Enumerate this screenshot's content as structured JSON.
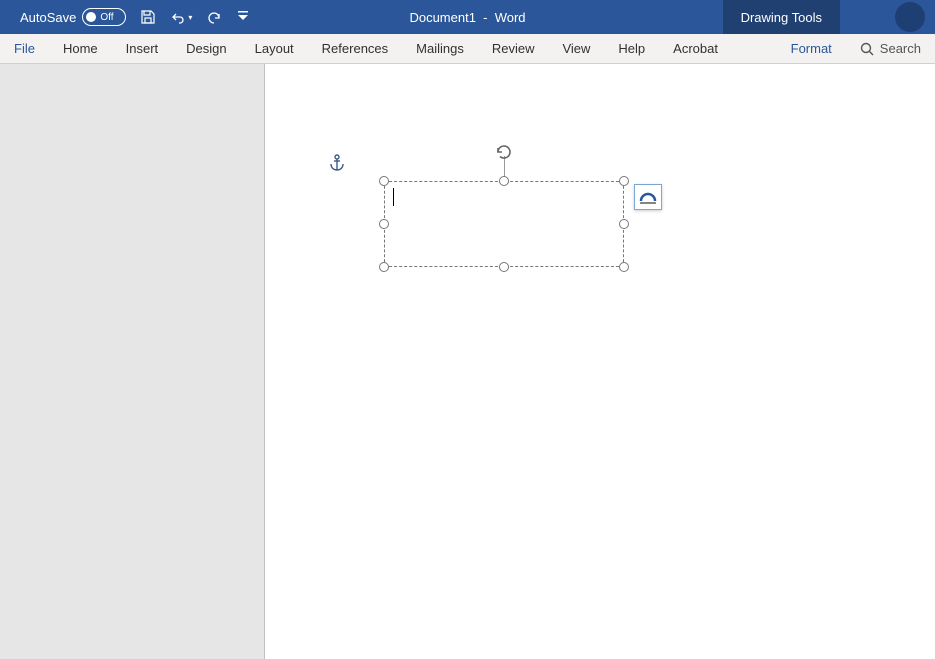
{
  "titlebar": {
    "autosave_label": "AutoSave",
    "autosave_state": "Off",
    "document_title": "Document1  -  Word",
    "drawing_tools": "Drawing Tools"
  },
  "ribbon": {
    "tabs": {
      "file": "File",
      "home": "Home",
      "insert": "Insert",
      "design": "Design",
      "layout": "Layout",
      "references": "References",
      "mailings": "Mailings",
      "review": "Review",
      "view": "View",
      "help": "Help",
      "acrobat": "Acrobat",
      "format": "Format"
    },
    "search_placeholder": "Search"
  }
}
